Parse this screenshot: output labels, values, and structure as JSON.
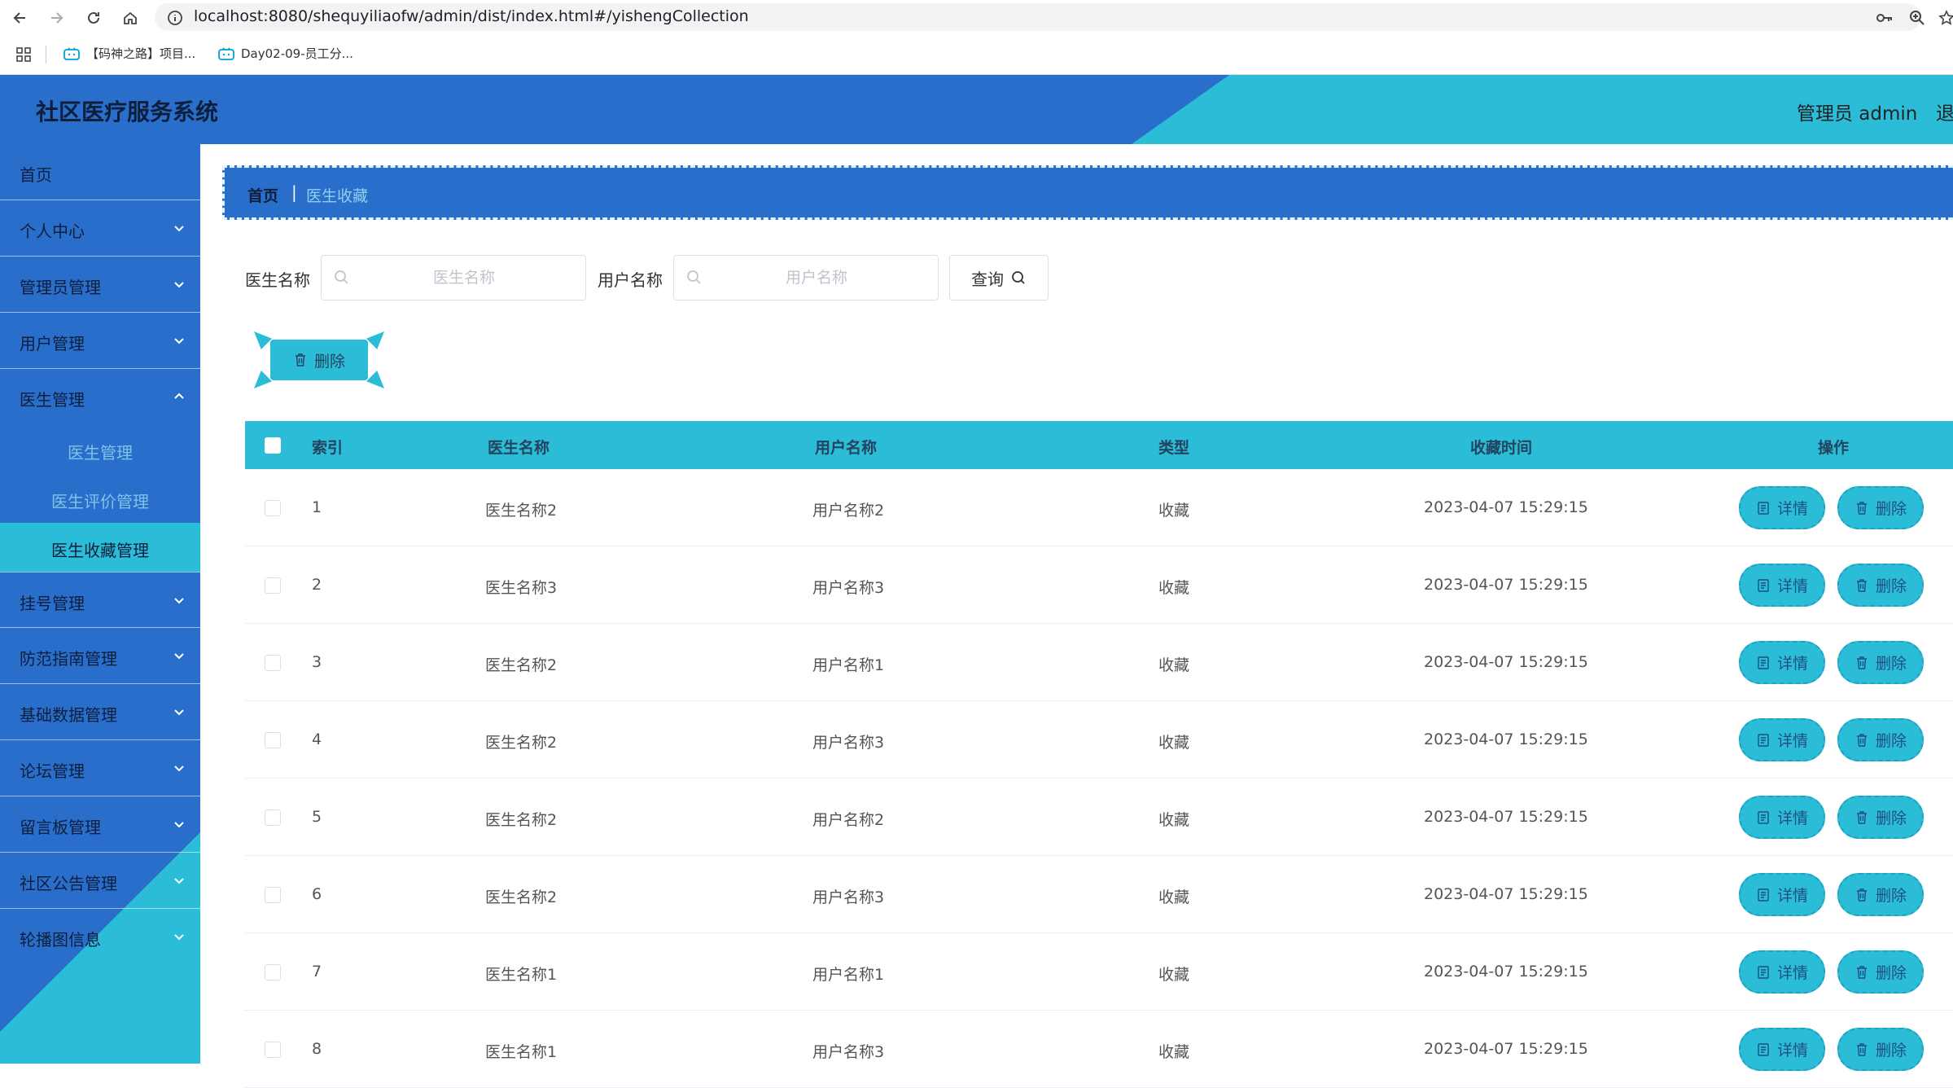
{
  "browser": {
    "url": "localhost:8080/shequyiliaofw/admin/dist/index.html#/yishengCollection",
    "bookmarks": [
      {
        "label": "【码神之路】项目..."
      },
      {
        "label": "Day02-09-员工分..."
      }
    ]
  },
  "header": {
    "title": "社区医疗服务系统",
    "admin": "管理员 admin",
    "logout": "退"
  },
  "sidebar": {
    "items": [
      {
        "label": "首页"
      },
      {
        "label": "个人中心"
      },
      {
        "label": "管理员管理"
      },
      {
        "label": "用户管理"
      },
      {
        "label": "医生管理"
      },
      {
        "label": "挂号管理"
      },
      {
        "label": "防范指南管理"
      },
      {
        "label": "基础数据管理"
      },
      {
        "label": "论坛管理"
      },
      {
        "label": "留言板管理"
      },
      {
        "label": "社区公告管理"
      },
      {
        "label": "轮播图信息"
      }
    ],
    "subitems": [
      {
        "label": "医生管理"
      },
      {
        "label": "医生评价管理"
      },
      {
        "label": "医生收藏管理"
      }
    ]
  },
  "breadcrumb": {
    "home": "首页",
    "sep": "|",
    "current": "医生收藏"
  },
  "search": {
    "doctor_label": "医生名称",
    "doctor_placeholder": "医生名称",
    "user_label": "用户名称",
    "user_placeholder": "用户名称",
    "query": "查询"
  },
  "actions": {
    "bulk_delete": "删除"
  },
  "table": {
    "headers": {
      "index": "索引",
      "doctor": "医生名称",
      "user": "用户名称",
      "type": "类型",
      "time": "收藏时间",
      "ops": "操作"
    },
    "detail_label": "详情",
    "delete_label": "删除",
    "rows": [
      {
        "index": "1",
        "doctor": "医生名称2",
        "user": "用户名称2",
        "type": "收藏",
        "time": "2023-04-07 15:29:15"
      },
      {
        "index": "2",
        "doctor": "医生名称3",
        "user": "用户名称3",
        "type": "收藏",
        "time": "2023-04-07 15:29:15"
      },
      {
        "index": "3",
        "doctor": "医生名称2",
        "user": "用户名称1",
        "type": "收藏",
        "time": "2023-04-07 15:29:15"
      },
      {
        "index": "4",
        "doctor": "医生名称2",
        "user": "用户名称3",
        "type": "收藏",
        "time": "2023-04-07 15:29:15"
      },
      {
        "index": "5",
        "doctor": "医生名称2",
        "user": "用户名称2",
        "type": "收藏",
        "time": "2023-04-07 15:29:15"
      },
      {
        "index": "6",
        "doctor": "医生名称2",
        "user": "用户名称3",
        "type": "收藏",
        "time": "2023-04-07 15:29:15"
      },
      {
        "index": "7",
        "doctor": "医生名称1",
        "user": "用户名称1",
        "type": "收藏",
        "time": "2023-04-07 15:29:15"
      },
      {
        "index": "8",
        "doctor": "医生名称1",
        "user": "用户名称3",
        "type": "收藏",
        "time": "2023-04-07 15:29:15"
      }
    ]
  },
  "colors": {
    "primary_blue": "#2a6ecb",
    "accent_cyan": "#2bbcd8"
  }
}
